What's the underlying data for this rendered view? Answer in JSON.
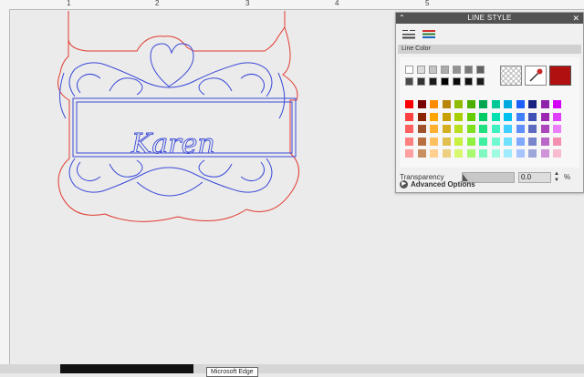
{
  "ruler": {
    "marks": [
      "1",
      "2",
      "3",
      "4",
      "5"
    ]
  },
  "design": {
    "text": "Karen",
    "cut_color": "#e03a2f",
    "line_color": "#3a49d8"
  },
  "panel": {
    "title": "LINE STYLE",
    "section_label": "Line Color",
    "transparency_label": "Transparency",
    "transparency_value": "0.0",
    "transparency_unit": "%",
    "transparency_level": 0,
    "advanced_label": "Advanced Options",
    "current_color": "#b01010",
    "grays": [
      "#ffffff",
      "#dcdcdc",
      "#c4c4c4",
      "#ababab",
      "#939393",
      "#7a7a7a",
      "#626262",
      "#4a4a4a",
      "#333333",
      "#1a1a1a",
      "#000000",
      "#0b0b0b",
      "#111111",
      "#1c1c1c"
    ],
    "colors": [
      [
        "#ff0000",
        "#7a0000",
        "#ff8c00",
        "#b8860b",
        "#8fbc00",
        "#4caf00",
        "#00a651",
        "#00c896",
        "#00a8e0",
        "#1e5fff",
        "#1a237e",
        "#8e24aa",
        "#d500f9"
      ],
      [
        "#ff4040",
        "#8b2500",
        "#ffa500",
        "#c8a000",
        "#a8d000",
        "#66cc00",
        "#00cc66",
        "#00e0b0",
        "#00c0f0",
        "#4080ff",
        "#3f51b5",
        "#9c27b0",
        "#e040fb"
      ],
      [
        "#ff6060",
        "#a0522d",
        "#ffb030",
        "#d4b020",
        "#b8e020",
        "#80e020",
        "#20e080",
        "#40f0c0",
        "#40d0ff",
        "#6090ff",
        "#5c6bc0",
        "#ab47bc",
        "#ea80fc"
      ],
      [
        "#ff8080",
        "#b87040",
        "#ffc060",
        "#e0c050",
        "#c8f040",
        "#90f040",
        "#40f0a0",
        "#70f8d0",
        "#70e0ff",
        "#80a8ff",
        "#7986cb",
        "#ba68c8",
        "#f48fb1"
      ],
      [
        "#ffa0a0",
        "#c89060",
        "#ffd090",
        "#ecd080",
        "#d8f870",
        "#a8f870",
        "#80f8c0",
        "#a0fce0",
        "#a0ecff",
        "#a8c4ff",
        "#9fa8da",
        "#ce93d8",
        "#f8bbd0"
      ]
    ]
  }
}
